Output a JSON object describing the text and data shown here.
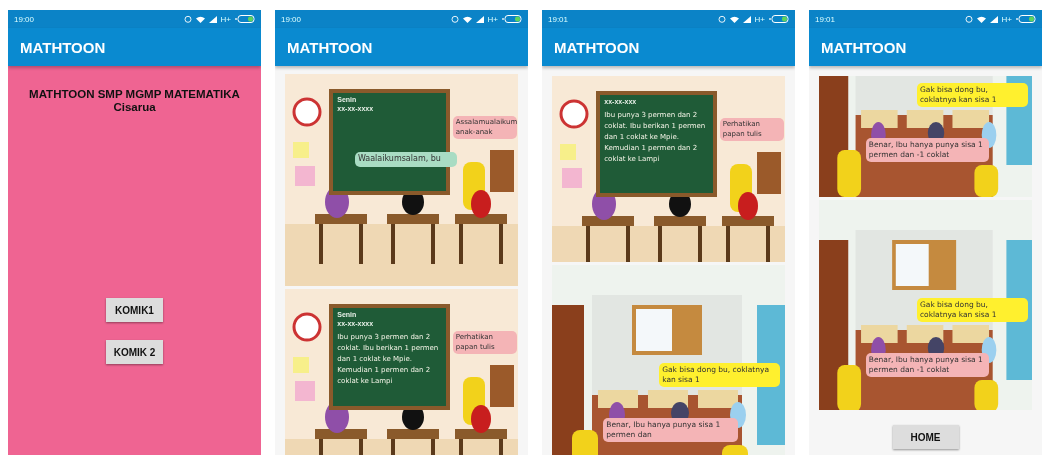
{
  "phones": [
    {
      "status": {
        "time": "19:00",
        "network": "H+"
      },
      "app_title": "MATHTOON",
      "kind": "home",
      "heading": [
        "MATHTOON SMP MGMP MATEMATIKA",
        "Cisarua"
      ],
      "buttons": [
        "KOMIK1",
        "KOMIK 2"
      ]
    },
    {
      "status": {
        "time": "19:00",
        "network": "H+"
      },
      "app_title": "MATHTOON",
      "kind": "comic",
      "panels": [
        {
          "kind": "board",
          "board": {
            "day": "Senin",
            "date": "xx-xx-xxxx"
          },
          "bubbles": [
            {
              "kind": "teacher",
              "text": "Assalamualaikum anak-anak",
              "color": "#f4b4b6"
            },
            {
              "kind": "students",
              "text": "Waalaikumsalam, bu",
              "color": "#a9dcc3"
            }
          ]
        },
        {
          "kind": "board",
          "board": {
            "day": "Senin",
            "date": "xx-xx-xxxx",
            "text": "Ibu punya 3 permen dan 2 coklat. Ibu berikan 1 permen dan 1 coklat ke Mpie. Kemudian 1 permen dan 2 coklat ke Lampi"
          },
          "bubbles": [
            {
              "kind": "teacher",
              "text": "Perhatikan papan tulis",
              "color": "#f4b4b6"
            }
          ]
        }
      ]
    },
    {
      "status": {
        "time": "19:01",
        "network": "H+"
      },
      "app_title": "MATHTOON",
      "kind": "comic",
      "panels": [
        {
          "kind": "board",
          "board": {
            "date": "xx-xx-xxx",
            "text": "Ibu punya 3 permen dan 2 coklat. Ibu berikan 1 permen dan 1 coklat ke Mpie. Kemudian 1 permen dan 2 coklat ke Lampi"
          },
          "bubbles": [
            {
              "kind": "teacher",
              "text": "Perhatikan papan tulis",
              "color": "#f4b4b6"
            }
          ]
        },
        {
          "kind": "room",
          "bubbles": [
            {
              "kind": "student",
              "text": "Gak bisa dong bu, coklatnya kan sisa 1",
              "color": "#fff02e"
            },
            {
              "kind": "teacher",
              "text": "Benar, Ibu hanya punya sisa 1 permen dan",
              "color": "#f4b4b6"
            }
          ]
        }
      ]
    },
    {
      "status": {
        "time": "19:01",
        "network": "H+"
      },
      "app_title": "MATHTOON",
      "kind": "comic",
      "panels": [
        {
          "kind": "room",
          "bubbles": [
            {
              "kind": "student",
              "text": "Gak bisa dong bu, coklatnya kan sisa 1",
              "color": "#fff02e"
            },
            {
              "kind": "teacher",
              "text": "Benar, Ibu hanya punya sisa 1 permen dan -1 coklat",
              "color": "#f4b4b6"
            }
          ]
        },
        {
          "kind": "room",
          "bubbles": [
            {
              "kind": "student",
              "text": "Gak bisa dong bu, coklatnya kan sisa 1",
              "color": "#fff02e"
            },
            {
              "kind": "teacher",
              "text": "Benar, Ibu hanya punya sisa 1 permen dan -1 coklat",
              "color": "#f4b4b6"
            }
          ]
        }
      ],
      "button": "HOME"
    }
  ]
}
